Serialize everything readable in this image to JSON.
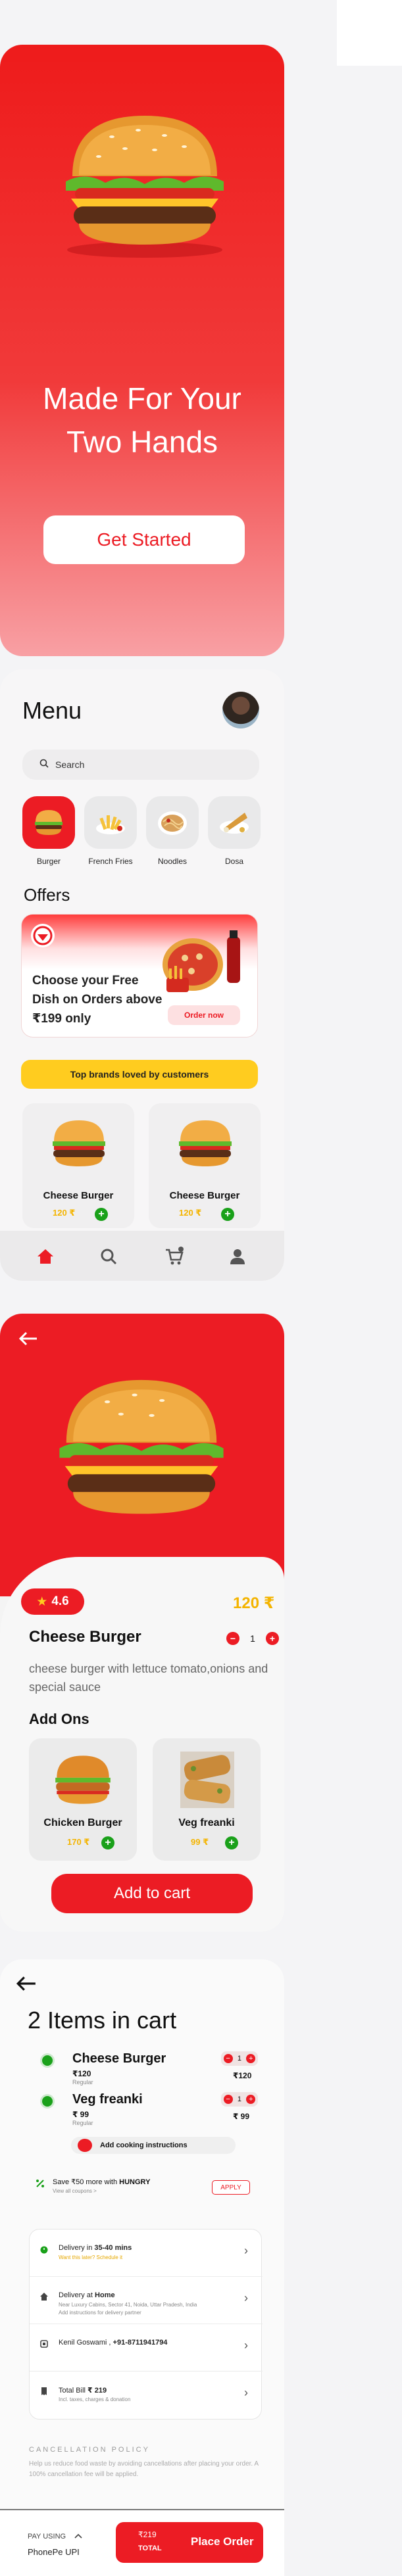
{
  "splash": {
    "title_line1": "Made For Your",
    "title_line2": "Two Hands",
    "cta": "Get Started"
  },
  "menu": {
    "title": "Menu",
    "search_placeholder": "Search",
    "categories": [
      {
        "label": "Burger"
      },
      {
        "label": "French Fries"
      },
      {
        "label": "Noodles"
      },
      {
        "label": "Dosa"
      }
    ],
    "offers_title": "Offers",
    "offer_text": "Choose your Free Dish on Orders above ₹199 only",
    "offer_button": "Order now",
    "brands_banner": "Top brands loved by customers",
    "products": [
      {
        "name": "Cheese Burger",
        "price": "120 ₹"
      },
      {
        "name": "Cheese Burger",
        "price": "120 ₹"
      }
    ]
  },
  "detail": {
    "rating": "4.6",
    "price": "120 ₹",
    "name": "Cheese Burger",
    "qty_minus": "−",
    "quantity": "1",
    "qty_plus": "+",
    "description": "cheese burger with lettuce tomato,onions and special sauce",
    "addons_title": "Add Ons",
    "addons": [
      {
        "name": "Chicken Burger",
        "price": "170 ₹"
      },
      {
        "name": "Veg freanki",
        "price": "99 ₹"
      }
    ],
    "add_to_cart": "Add to cart"
  },
  "cart": {
    "title": "2 Items in cart",
    "items": [
      {
        "name": "Cheese Burger",
        "price": "₹120",
        "size": "Regular",
        "qty": "1",
        "total": "₹120"
      },
      {
        "name": "Veg freanki",
        "price": "₹ 99",
        "size": "Regular",
        "qty": "1",
        "total": "₹ 99"
      }
    ],
    "cooking_instructions": "Add cooking instructions",
    "coupon_text_prefix": "Save ₹50 more with ",
    "coupon_code": "HUNGRY",
    "coupon_sub": "View all coupons >",
    "apply": "APPLY",
    "info_rows": [
      {
        "title_prefix": "Delivery in ",
        "title_bold": "35-40 mins",
        "sub": "Want this later? Schedule it"
      },
      {
        "title_prefix": "Delivery at ",
        "title_bold": "Home",
        "sub": "Near Luxury Cabins, Sector 41, Noida, Uttar Pradesh, India"
      },
      {
        "title_prefix": "Kenil Goswami , ",
        "title_bold": "+91-8711941794",
        "sub": ""
      },
      {
        "title_prefix": "Total Bill ",
        "title_bold": "₹ 219",
        "sub": "Incl. taxes, charges & donation"
      }
    ],
    "info_sub_extra": "Add instructions for delivery partner",
    "policy_title": "CANCELLATION POLICY",
    "policy_text": "Help us reduce food waste by avoiding cancellations after placing your order. A 100% cancellation fee will be applied.",
    "pay_using": "PAY USING",
    "pay_method": "PhonePe UPI",
    "place_amount": "₹219",
    "place_total": "TOTAL",
    "place_label": "Place Order"
  },
  "colors": {
    "primary": "#ec1c24",
    "accent": "#f4b400",
    "yellow": "#ffcc1f",
    "veg": "#1aa11a"
  }
}
